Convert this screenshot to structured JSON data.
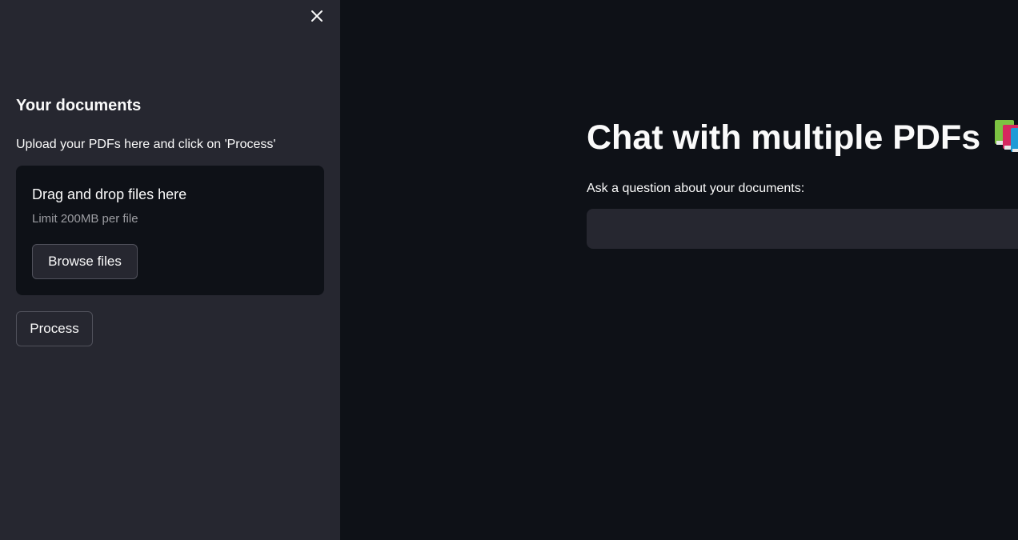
{
  "sidebar": {
    "close_icon": "close-icon",
    "header": "Your documents",
    "upload_label": "Upload your PDFs here and click on 'Process'",
    "dropzone": {
      "title": "Drag and drop files here",
      "limit": "Limit 200MB per file",
      "browse_label": "Browse files"
    },
    "process_label": "Process"
  },
  "main": {
    "title": "Chat with multiple PDFs",
    "title_icon": "books-icon",
    "question_label": "Ask a question about your documents:",
    "question_value": ""
  },
  "colors": {
    "sidebar_bg": "#262730",
    "main_bg": "#0e1117",
    "text": "#fafafa",
    "muted_text": "#9c9da2",
    "button_border": "#50515b"
  }
}
